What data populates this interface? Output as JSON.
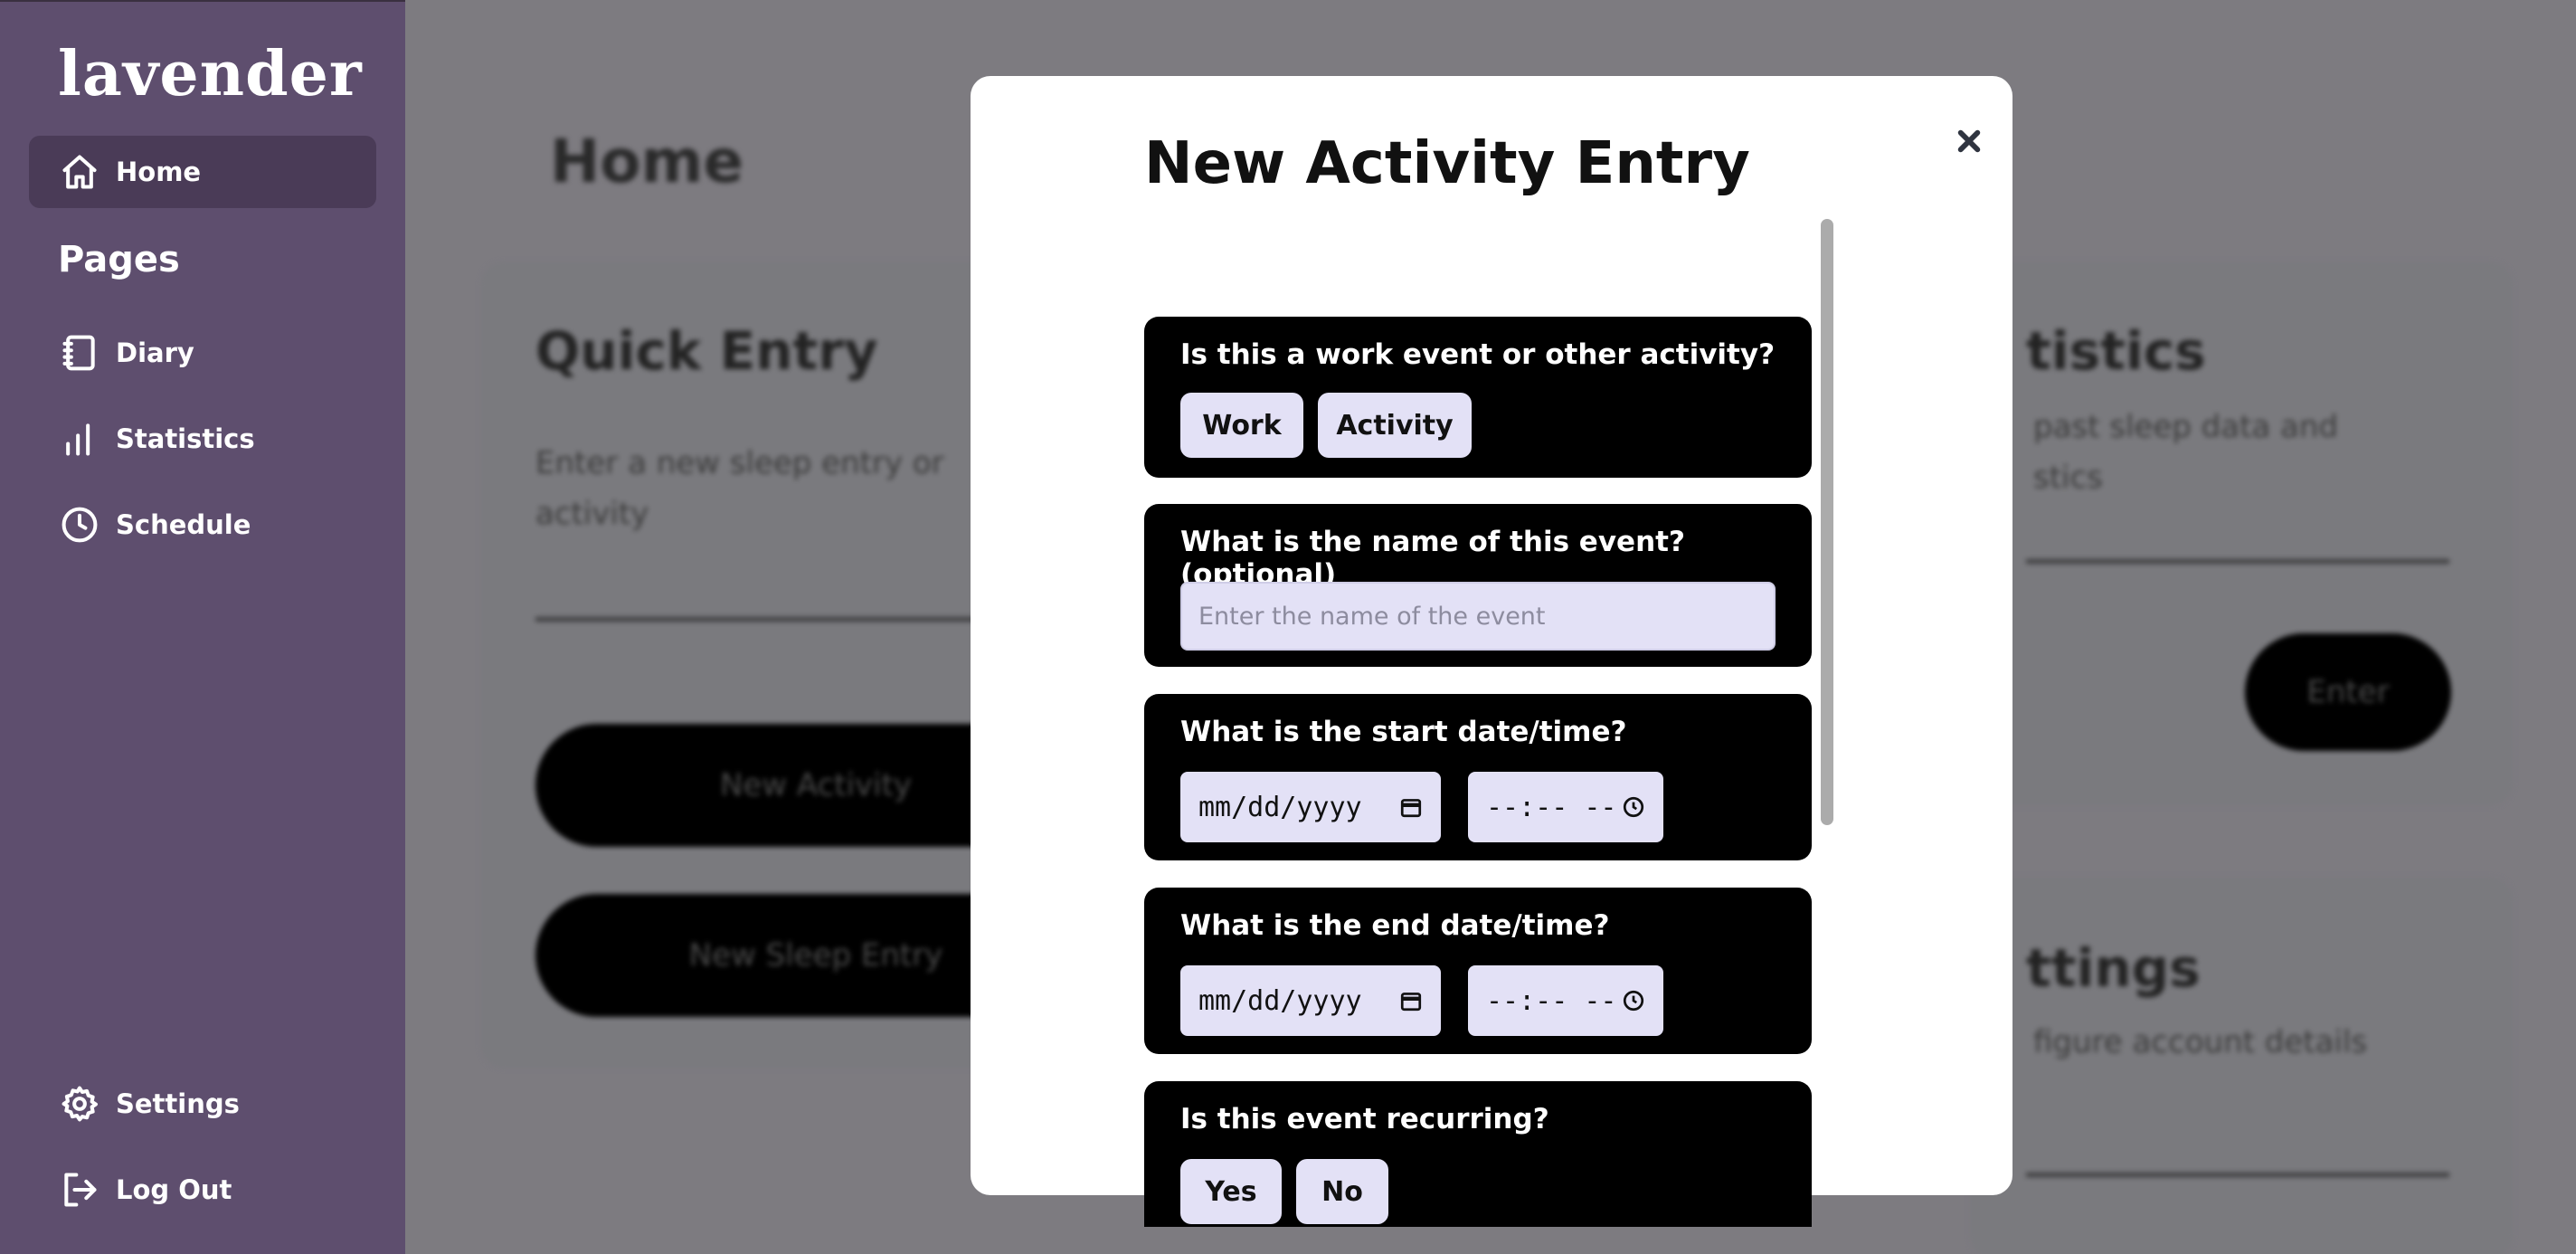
{
  "app": {
    "logo": "lavender"
  },
  "sidebar": {
    "nav_top": {
      "label": "Home",
      "icon": "home-icon"
    },
    "pages_heading": "Pages",
    "items": [
      {
        "label": "Diary",
        "icon": "notebook-icon"
      },
      {
        "label": "Statistics",
        "icon": "bar-chart-icon"
      },
      {
        "label": "Schedule",
        "icon": "clock-icon"
      }
    ],
    "bottom": [
      {
        "label": "Settings",
        "icon": "gear-icon"
      },
      {
        "label": "Log Out",
        "icon": "logout-icon"
      }
    ]
  },
  "background": {
    "page_title": "Home",
    "quick_entry": {
      "title": "Quick Entry",
      "desc_line1": "Enter a new sleep entry or",
      "desc_line2": "activity",
      "btn_activity": "New Activity",
      "btn_sleep": "New Sleep Entry"
    },
    "statistics": {
      "title": "tistics",
      "desc_line1": "past sleep data and",
      "desc_line2": "stics",
      "btn": "Enter"
    },
    "settings": {
      "title": "ttings",
      "desc": "figure account details"
    }
  },
  "modal": {
    "title": "New Activity Entry",
    "questions": {
      "type": {
        "label": "Is this a work event or other activity?",
        "options": [
          "Work",
          "Activity"
        ]
      },
      "name": {
        "label": "What is the name of this event? (optional)",
        "placeholder": "Enter the name of the event"
      },
      "start": {
        "label": "What is the start date/time?",
        "date_placeholder": "mm/dd/yyyy",
        "time_placeholder": "--:-- --"
      },
      "end": {
        "label": "What is the end date/time?",
        "date_placeholder": "mm/dd/yyyy",
        "time_placeholder": "--:-- --"
      },
      "recurring": {
        "label": "Is this event recurring?",
        "options": [
          "Yes",
          "No"
        ]
      }
    }
  },
  "colors": {
    "sidebar_bg": "#5e4e6e",
    "sidebar_active": "#4a3b57",
    "chip_bg": "#e3e1f6",
    "question_bg": "#000000"
  }
}
